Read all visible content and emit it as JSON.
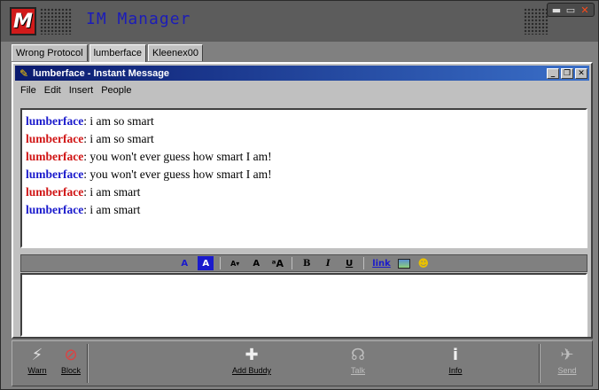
{
  "app": {
    "logo_letter": "M",
    "title": "IM Manager",
    "controls": {
      "minimize": "▬",
      "maximize": "▭",
      "close": "✕"
    }
  },
  "tabs": [
    {
      "label": "Wrong Protocol",
      "active": false
    },
    {
      "label": "lumberface",
      "active": true
    },
    {
      "label": "Kleenex00",
      "active": false
    }
  ],
  "im_window": {
    "title": "lumberface - Instant Message",
    "controls": {
      "minimize": "_",
      "restore": "❐",
      "close": "✕"
    },
    "menu": [
      "File",
      "Edit",
      "Insert",
      "People"
    ]
  },
  "conversation": [
    {
      "sender": "lumberface",
      "color": "#1a1acc",
      "text": ": i am so smart"
    },
    {
      "sender": "lumberface",
      "color": "#d01414",
      "text": ": i am so smart"
    },
    {
      "sender": "lumberface",
      "color": "#d01414",
      "text": ": you won't ever guess how smart I am!"
    },
    {
      "sender": "lumberface",
      "color": "#1a1acc",
      "text": ": you won't ever guess how smart I am!"
    },
    {
      "sender": "lumberface",
      "color": "#d01414",
      "text": ": i am smart"
    },
    {
      "sender": "lumberface",
      "color": "#1a1acc",
      "text": ": i am smart"
    }
  ],
  "format_toolbar": {
    "text_color": "A",
    "back_color": "A",
    "smaller": "A▾",
    "normal": "A",
    "larger": "ᵃA",
    "bold": "B",
    "italic": "I",
    "underline": "U",
    "link": "link"
  },
  "compose": {
    "value": ""
  },
  "actions": {
    "warn": "Warn",
    "block": "Block",
    "add_buddy": "Add Buddy",
    "talk": "Talk",
    "info": "Info",
    "send": "Send"
  }
}
